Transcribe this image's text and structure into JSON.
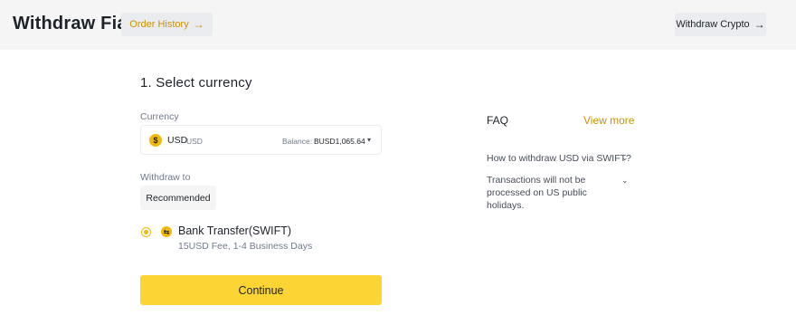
{
  "header": {
    "title": "Withdraw Fiat",
    "order_history_label": "Order History",
    "withdraw_crypto_label": "Withdraw Crypto",
    "arrow_icon": "→"
  },
  "step": {
    "title": "1. Select currency"
  },
  "currency": {
    "label": "Currency",
    "icon_symbol": "$",
    "code": "USD",
    "name": "USD",
    "balance_label": "Balance:",
    "balance_value": "BUSD1,065.64",
    "dropdown_glyph": "▾"
  },
  "withdraw_to": {
    "label": "Withdraw to",
    "tab_label": "Recommended",
    "method_name": "Bank Transfer(SWIFT)",
    "method_fee": "15USD Fee, 1-4 Business Days",
    "method_icon_glyph": "⇆",
    "selected": true
  },
  "continue_label": "Continue",
  "faq": {
    "title": "FAQ",
    "view_more": "View more",
    "items": [
      {
        "text": "How to withdraw USD via SWIFT?"
      },
      {
        "text": "Transactions will not be processed on US public holidays."
      }
    ],
    "chevron_glyph": "⌄"
  },
  "colors": {
    "accent": "#fcd535",
    "brand_text": "#c99400",
    "header_bg": "#f5f5f5"
  }
}
